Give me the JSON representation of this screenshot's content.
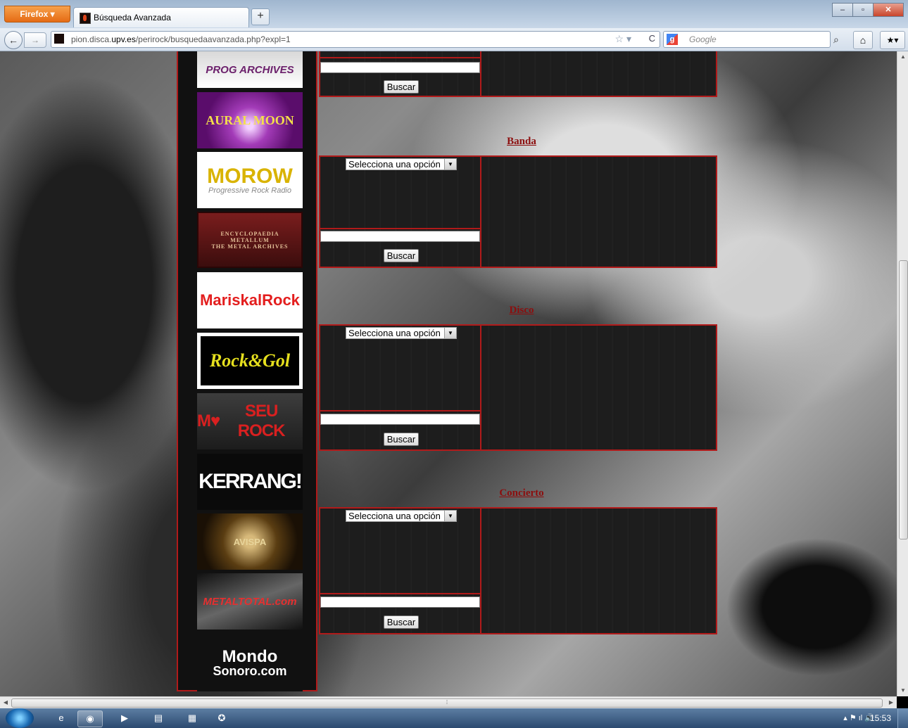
{
  "browser": {
    "app_button": "Firefox",
    "tab_title": "Búsqueda Avanzada",
    "new_tab": "+",
    "url_prefix": "pion.disca.",
    "url_domain": "upv.es",
    "url_path": "/perirock/busquedaavanzada.php?expl=1",
    "search_engine": "Google"
  },
  "sidebar": {
    "banners": [
      {
        "name": "progarchives-banner",
        "text": "PROG ARCHIVES"
      },
      {
        "name": "aural-moon-banner",
        "text": "AURAL MOON"
      },
      {
        "name": "morow-banner",
        "text": "MOROW",
        "sub": "Progressive Rock Radio"
      },
      {
        "name": "metal-archives-banner",
        "line1": "ENCYCLOPAEDIA",
        "line2": "METALLUM",
        "line3": "THE METAL ARCHIVES"
      },
      {
        "name": "mariskal-rock-banner",
        "text_a": "Mariskal",
        "text_b": "Rock"
      },
      {
        "name": "rock-gol-banner",
        "text": "Rock&Gol"
      },
      {
        "name": "museu-rock-banner",
        "text_a": "M",
        "text_b": "♥",
        "text_c": "SEU ROCK"
      },
      {
        "name": "kerrang-banner",
        "text": "KERRANG!"
      },
      {
        "name": "avispa-banner",
        "text": "AVISPA"
      },
      {
        "name": "metaltotal-banner",
        "text_a": "METALTOTAL",
        "text_b": ".com"
      },
      {
        "name": "mondo-sonoro-banner",
        "line1": "Mondo",
        "line2": "Sonoro.com"
      }
    ]
  },
  "sections": {
    "top": {
      "button": "Buscar"
    },
    "banda": {
      "title": "Banda",
      "select": "Selecciona una opción",
      "button": "Buscar"
    },
    "disco": {
      "title": "Disco",
      "select": "Selecciona una opción",
      "button": "Buscar"
    },
    "concierto": {
      "title": "Concierto",
      "select": "Selecciona una opción",
      "button": "Buscar"
    }
  },
  "taskbar": {
    "clock": "15:53"
  },
  "colors": {
    "accent_red": "#b11a1a",
    "section_title": "#8c0e0e"
  }
}
